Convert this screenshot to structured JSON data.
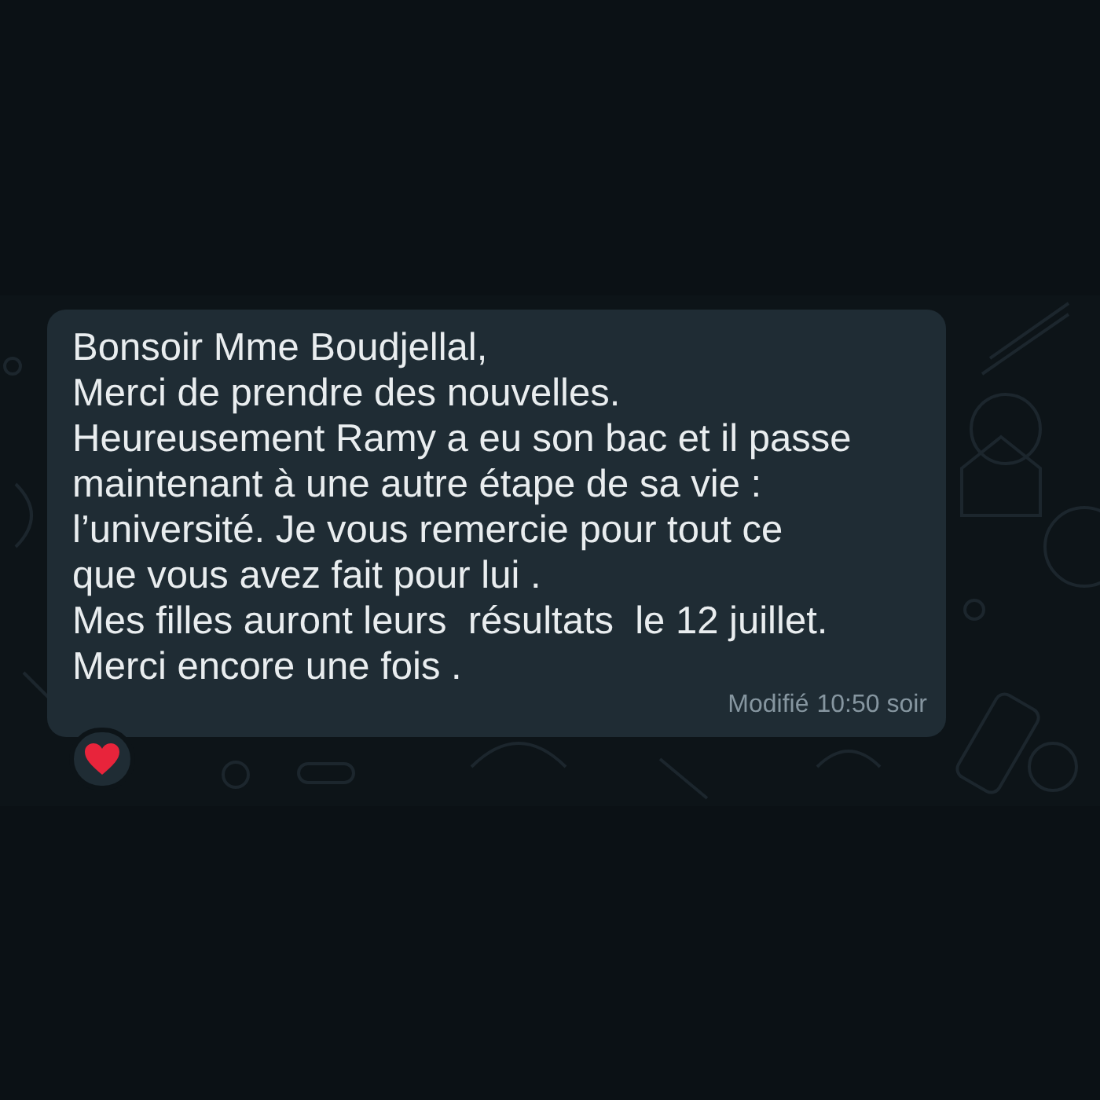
{
  "message": {
    "text": "Bonsoir Mme Boudjellal,\nMerci de prendre des nouvelles.\nHeureusement Ramy a eu son bac et il passe\nmaintenant à une autre étape de sa vie :\nl’université. Je vous remercie pour tout ce\nque vous avez fait pour lui .\nMes filles auront leurs  résultats  le 12 juillet.\nMerci encore une fois .",
    "edited_label": "Modifié",
    "time": "10:50 soir",
    "reactions": [
      {
        "kind": "heart"
      }
    ]
  }
}
